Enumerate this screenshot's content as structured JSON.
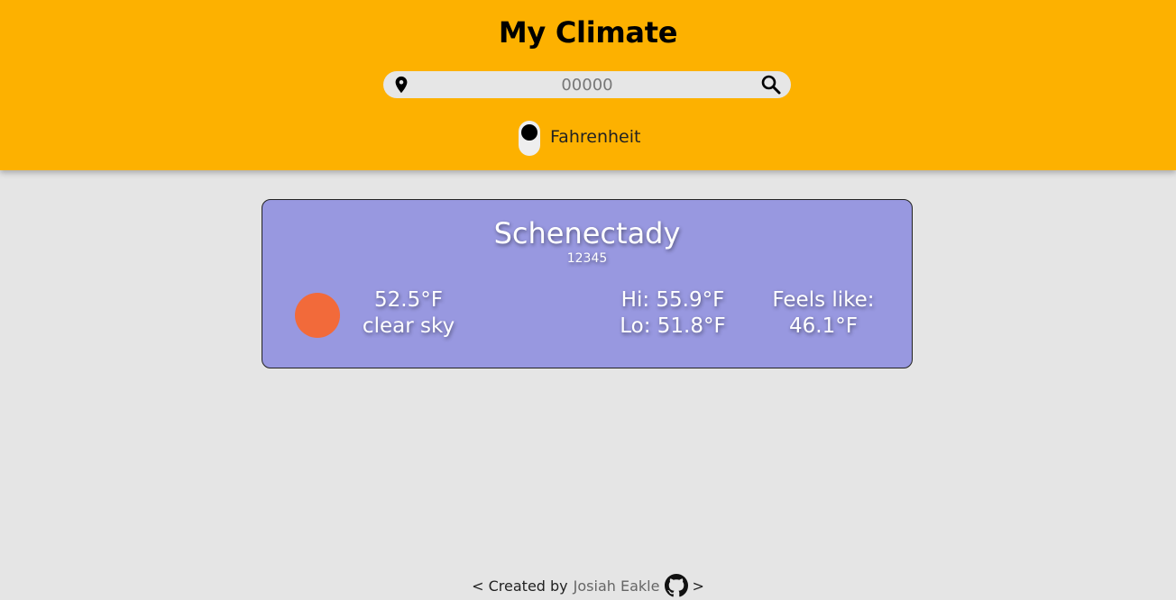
{
  "header": {
    "title": "My Climate",
    "search": {
      "placeholder": "00000",
      "value": ""
    },
    "unit_label": "Fahrenheit"
  },
  "card": {
    "city": "Schenectady",
    "zip": "12345",
    "temp": "52.5°F",
    "description": "clear sky",
    "hi": "Hi: 55.9°F",
    "lo": "Lo: 51.8°F",
    "feels_label": "Feels like:",
    "feels_value": "46.1°F",
    "icon": "sun-icon"
  },
  "footer": {
    "prefix": "< Created by",
    "author": "Josiah Eakle",
    "suffix": ">"
  },
  "colors": {
    "header_bg": "#fdb100",
    "card_bg": "#9898e0",
    "sun": "#f26a3a",
    "page_bg": "#e5e5e5"
  }
}
